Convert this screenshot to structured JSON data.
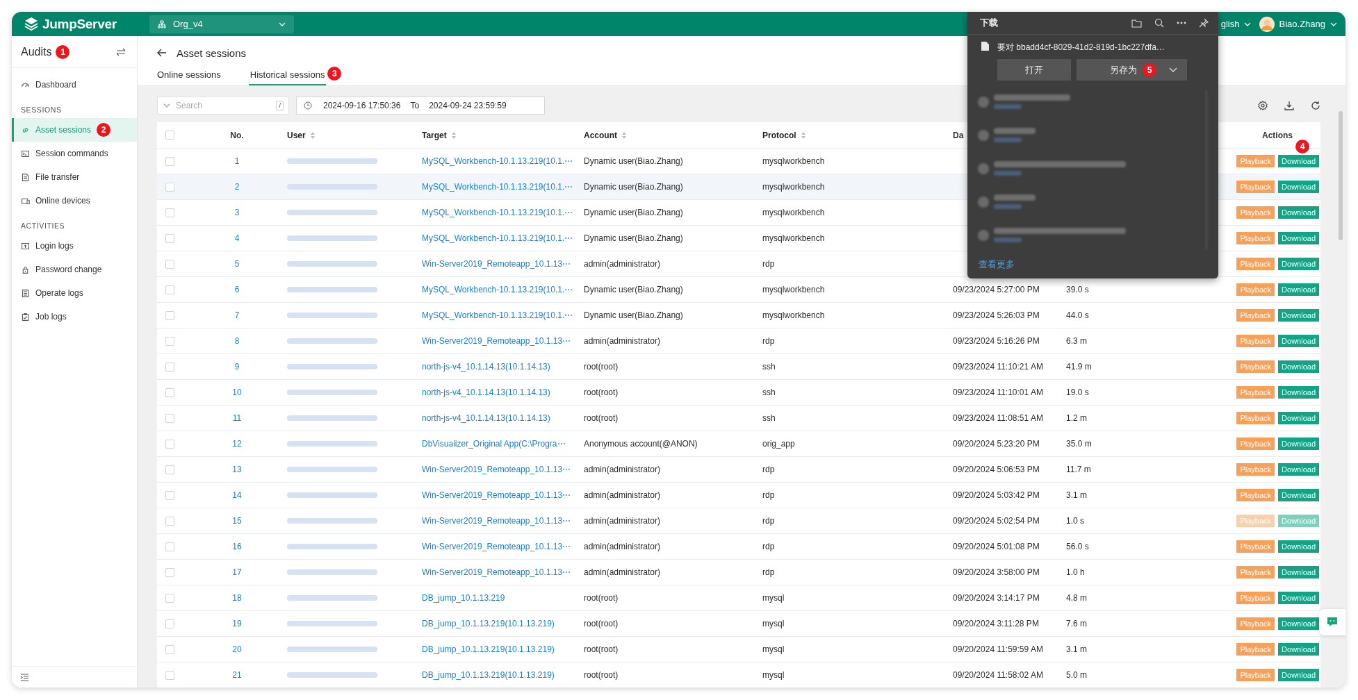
{
  "header": {
    "logo": "JumpServer",
    "org": "Org_v4",
    "language": "glish",
    "user": "Biao.Zhang"
  },
  "sidebar": {
    "title": "Audits",
    "badge": "1",
    "groups": [
      {
        "items": [
          {
            "label": "Dashboard",
            "selected": false
          }
        ]
      },
      {
        "heading": "SESSIONS",
        "items": [
          {
            "label": "Asset sessions",
            "selected": true,
            "badge": "2"
          },
          {
            "label": "Session commands",
            "selected": false
          },
          {
            "label": "File transfer",
            "selected": false
          },
          {
            "label": "Online devices",
            "selected": false
          }
        ]
      },
      {
        "heading": "ACTIVITIES",
        "items": [
          {
            "label": "Login logs",
            "selected": false
          },
          {
            "label": "Password change",
            "selected": false
          },
          {
            "label": "Operate logs",
            "selected": false
          },
          {
            "label": "Job logs",
            "selected": false
          }
        ]
      }
    ]
  },
  "page": {
    "title": "Asset sessions",
    "tabs": [
      {
        "label": "Online sessions",
        "selected": false
      },
      {
        "label": "Historical sessions",
        "selected": true,
        "badge": "3"
      }
    ],
    "search": {
      "placeholder": "Search",
      "shortcut": "/"
    },
    "date_range": {
      "from": "2024-09-16 17:50:36",
      "separator": "To",
      "to": "2024-09-24 23:59:59"
    },
    "table": {
      "all_checked": false,
      "columns": [
        {
          "label": "No.",
          "sortable": false
        },
        {
          "label": "User",
          "sortable": true
        },
        {
          "label": "Target",
          "sortable": true
        },
        {
          "label": "Account",
          "sortable": true
        },
        {
          "label": "Protocol",
          "sortable": true
        },
        {
          "label": "Da",
          "sortable": false
        },
        {
          "label": "Actions",
          "sortable": false,
          "badge": "4"
        }
      ],
      "rows": [
        {
          "no": "1",
          "checked": false,
          "hovered": false,
          "disabled": false,
          "target": "MySQL_Workbench-10.1.13.219(10.1.⋯",
          "account": "Dynamic user(Biao.Zhang)",
          "protocol": "mysqlworkbench",
          "actions": [
            "Playback",
            "Download"
          ]
        },
        {
          "no": "2",
          "checked": false,
          "hovered": true,
          "disabled": false,
          "target": "MySQL_Workbench-10.1.13.219(10.1.⋯",
          "account": "Dynamic user(Biao.Zhang)",
          "protocol": "mysqlworkbench",
          "actions": [
            "Playback",
            "Download"
          ]
        },
        {
          "no": "3",
          "checked": false,
          "hovered": false,
          "disabled": false,
          "target": "MySQL_Workbench-10.1.13.219(10.1.⋯",
          "account": "Dynamic user(Biao.Zhang)",
          "protocol": "mysqlworkbench",
          "actions": [
            "Playback",
            "Download"
          ]
        },
        {
          "no": "4",
          "checked": false,
          "hovered": false,
          "disabled": false,
          "target": "MySQL_Workbench-10.1.13.219(10.1.⋯",
          "account": "Dynamic user(Biao.Zhang)",
          "protocol": "mysqlworkbench",
          "actions": [
            "Playback",
            "Download"
          ]
        },
        {
          "no": "5",
          "checked": false,
          "hovered": false,
          "disabled": false,
          "target": "Win-Server2019_Remoteapp_10.1.13⋯",
          "account": "admin(administrator)",
          "protocol": "rdp",
          "actions": [
            "Playback",
            "Download"
          ]
        },
        {
          "no": "6",
          "checked": false,
          "hovered": false,
          "disabled": false,
          "target": "MySQL_Workbench-10.1.13.219(10.1.⋯",
          "account": "Dynamic user(Biao.Zhang)",
          "protocol": "mysqlworkbench",
          "date": "09/23/2024 5:27:00 PM",
          "duration": "39.0 s",
          "actions": [
            "Playback",
            "Download"
          ]
        },
        {
          "no": "7",
          "checked": false,
          "hovered": false,
          "disabled": false,
          "target": "MySQL_Workbench-10.1.13.219(10.1.⋯",
          "account": "Dynamic user(Biao.Zhang)",
          "protocol": "mysqlworkbench",
          "date": "09/23/2024 5:26:03 PM",
          "duration": "44.0 s",
          "actions": [
            "Playback",
            "Download"
          ]
        },
        {
          "no": "8",
          "checked": false,
          "hovered": false,
          "disabled": false,
          "target": "Win-Server2019_Remoteapp_10.1.13⋯",
          "account": "admin(administrator)",
          "protocol": "rdp",
          "date": "09/23/2024 5:16:26 PM",
          "duration": "6.3 m",
          "actions": [
            "Playback",
            "Download"
          ]
        },
        {
          "no": "9",
          "checked": false,
          "hovered": false,
          "disabled": false,
          "target": "north-js-v4_10.1.14.13(10.1.14.13)",
          "account": "root(root)",
          "protocol": "ssh",
          "date": "09/23/2024 11:10:21 AM",
          "duration": "41.9 m",
          "actions": [
            "Playback",
            "Download"
          ]
        },
        {
          "no": "10",
          "checked": false,
          "hovered": false,
          "disabled": false,
          "target": "north-js-v4_10.1.14.13(10.1.14.13)",
          "account": "root(root)",
          "protocol": "ssh",
          "date": "09/23/2024 11:10:01 AM",
          "duration": "19.0 s",
          "actions": [
            "Playback",
            "Download"
          ]
        },
        {
          "no": "11",
          "checked": false,
          "hovered": false,
          "disabled": false,
          "target": "north-js-v4_10.1.14.13(10.1.14.13)",
          "account": "root(root)",
          "protocol": "ssh",
          "date": "09/23/2024 11:08:51 AM",
          "duration": "1.2 m",
          "actions": [
            "Playback",
            "Download"
          ]
        },
        {
          "no": "12",
          "checked": false,
          "hovered": false,
          "disabled": false,
          "target": "DbVisualizer_Original App(C:\\Progra⋯",
          "account": "Anonymous account(@ANON)",
          "protocol": "orig_app",
          "date": "09/20/2024 5:23:20 PM",
          "duration": "35.0 m",
          "actions": [
            "Playback",
            "Download"
          ]
        },
        {
          "no": "13",
          "checked": false,
          "hovered": false,
          "disabled": false,
          "target": "Win-Server2019_Remoteapp_10.1.13⋯",
          "account": "admin(administrator)",
          "protocol": "rdp",
          "date": "09/20/2024 5:06:53 PM",
          "duration": "11.7 m",
          "actions": [
            "Playback",
            "Download"
          ]
        },
        {
          "no": "14",
          "checked": false,
          "hovered": false,
          "disabled": false,
          "target": "Win-Server2019_Remoteapp_10.1.13⋯",
          "account": "admin(administrator)",
          "protocol": "rdp",
          "date": "09/20/2024 5:03:42 PM",
          "duration": "3.1 m",
          "actions": [
            "Playback",
            "Download"
          ]
        },
        {
          "no": "15",
          "checked": false,
          "hovered": false,
          "disabled": true,
          "target": "Win-Server2019_Remoteapp_10.1.13⋯",
          "account": "admin(administrator)",
          "protocol": "rdp",
          "date": "09/20/2024 5:02:54 PM",
          "duration": "1.0 s",
          "actions": [
            "Playback",
            "Download"
          ]
        },
        {
          "no": "16",
          "checked": false,
          "hovered": false,
          "disabled": false,
          "target": "Win-Server2019_Remoteapp_10.1.13⋯",
          "account": "admin(administrator)",
          "protocol": "rdp",
          "date": "09/20/2024 5:01:08 PM",
          "duration": "56.0 s",
          "actions": [
            "Playback",
            "Download"
          ]
        },
        {
          "no": "17",
          "checked": false,
          "hovered": false,
          "disabled": false,
          "target": "Win-Server2019_Remoteapp_10.1.13⋯",
          "account": "admin(administrator)",
          "protocol": "rdp",
          "date": "09/20/2024 3:58:00 PM",
          "duration": "1.0 h",
          "actions": [
            "Playback",
            "Download"
          ]
        },
        {
          "no": "18",
          "checked": false,
          "hovered": false,
          "disabled": false,
          "target": "DB_jump_10.1.13.219",
          "account": "root(root)",
          "protocol": "mysql",
          "date": "09/20/2024 3:14:17 PM",
          "duration": "4.8 m",
          "actions": [
            "Playback",
            "Download"
          ]
        },
        {
          "no": "19",
          "checked": false,
          "hovered": false,
          "disabled": false,
          "target": "DB_jump_10.1.13.219(10.1.13.219)",
          "account": "root(root)",
          "protocol": "mysql",
          "date": "09/20/2024 3:11:28 PM",
          "duration": "7.6 m",
          "actions": [
            "Playback",
            "Download"
          ]
        },
        {
          "no": "20",
          "checked": false,
          "hovered": false,
          "disabled": false,
          "target": "DB_jump_10.1.13.219(10.1.13.219)",
          "account": "root(root)",
          "protocol": "mysql",
          "date": "09/20/2024 11:59:59 AM",
          "duration": "3.1 m",
          "actions": [
            "Playback",
            "Download"
          ]
        },
        {
          "no": "21",
          "checked": false,
          "hovered": false,
          "disabled": false,
          "target": "DB_jump_10.1.13.219(10.1.13.219)",
          "account": "root(root)",
          "protocol": "mysql",
          "date": "09/20/2024 11:58:02 AM",
          "duration": "5.0 m",
          "actions": [
            "Playback",
            "Download"
          ]
        }
      ]
    }
  },
  "download_panel": {
    "title": "下载",
    "file": "要对 bbadd4cf-8029-41d2-819d-1bc227dfa…",
    "buttons": [
      {
        "label": "打开",
        "dropdown": false
      },
      {
        "label": "另存为",
        "dropdown": true,
        "badge": "5"
      }
    ],
    "more_link": "查看更多"
  }
}
